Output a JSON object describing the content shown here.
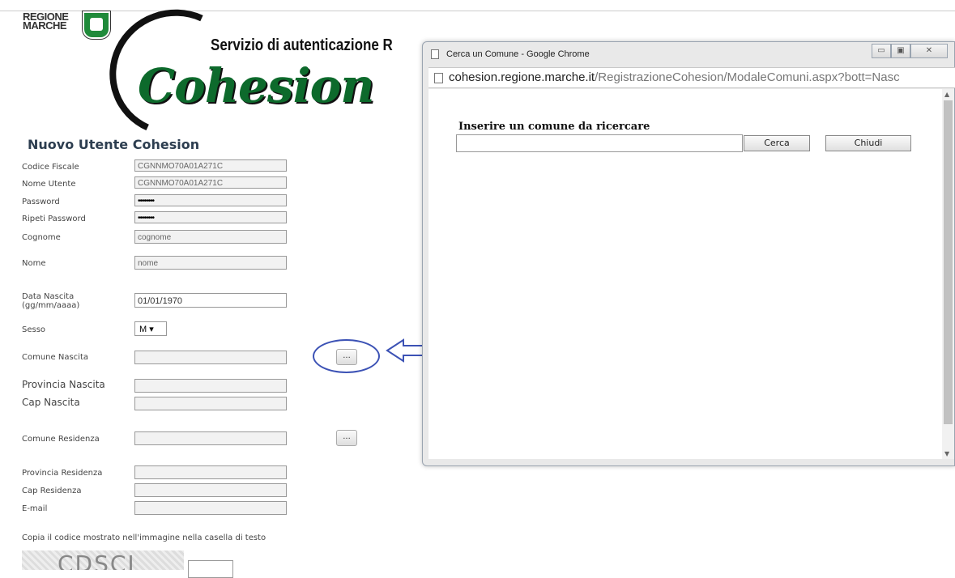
{
  "header": {
    "logo_text": "REGIONE\nMARCHE",
    "service_title": "Servizio di autenticazione R",
    "brand": "Cohesion"
  },
  "form": {
    "title": "Nuovo Utente Cohesion",
    "fields": {
      "codice_fiscale": {
        "label": "Codice Fiscale",
        "value": "CGNNMO70A01A271C"
      },
      "nome_utente": {
        "label": "Nome Utente",
        "value": "CGNNMO70A01A271C"
      },
      "password": {
        "label": "Password",
        "value": "••••••••"
      },
      "ripeti_password": {
        "label": "Ripeti Password",
        "value": "••••••••"
      },
      "cognome": {
        "label": "Cognome",
        "value": "cognome"
      },
      "nome": {
        "label": "Nome",
        "value": "nome"
      },
      "data_nascita": {
        "label": "Data Nascita\n(gg/mm/aaaa)",
        "value": "01/01/1970"
      },
      "sesso": {
        "label": "Sesso",
        "value": "M ▾"
      },
      "comune_nascita": {
        "label": "Comune Nascita",
        "value": ""
      },
      "provincia_nascita": {
        "label": "Provincia Nascita",
        "value": ""
      },
      "cap_nascita": {
        "label": "Cap Nascita",
        "value": ""
      },
      "comune_residenza": {
        "label": "Comune Residenza",
        "value": ""
      },
      "provincia_residenza": {
        "label": "Provincia Residenza",
        "value": ""
      },
      "cap_residenza": {
        "label": "Cap Residenza",
        "value": ""
      },
      "email": {
        "label": "E-mail",
        "value": ""
      }
    },
    "lookup_button_label": "...",
    "captcha_label": "Copia il codice mostrato nell'immagine nella casella di testo",
    "captcha_text": "CDSCI"
  },
  "popup": {
    "window_title": "Cerca un Comune - Google Chrome",
    "url_host": "cohesion.regione.marche.it",
    "url_path": "/RegistrazioneCohesion/ModaleComuni.aspx?bott=Nasc",
    "minimize": "▭",
    "maximize": "▣",
    "close": "✕",
    "search_label": "Inserire un comune da ricercare",
    "search_value": "",
    "search_button": "Cerca",
    "close_button": "Chiudi"
  },
  "annotation": {
    "highlight_color": "#3c52b5"
  }
}
